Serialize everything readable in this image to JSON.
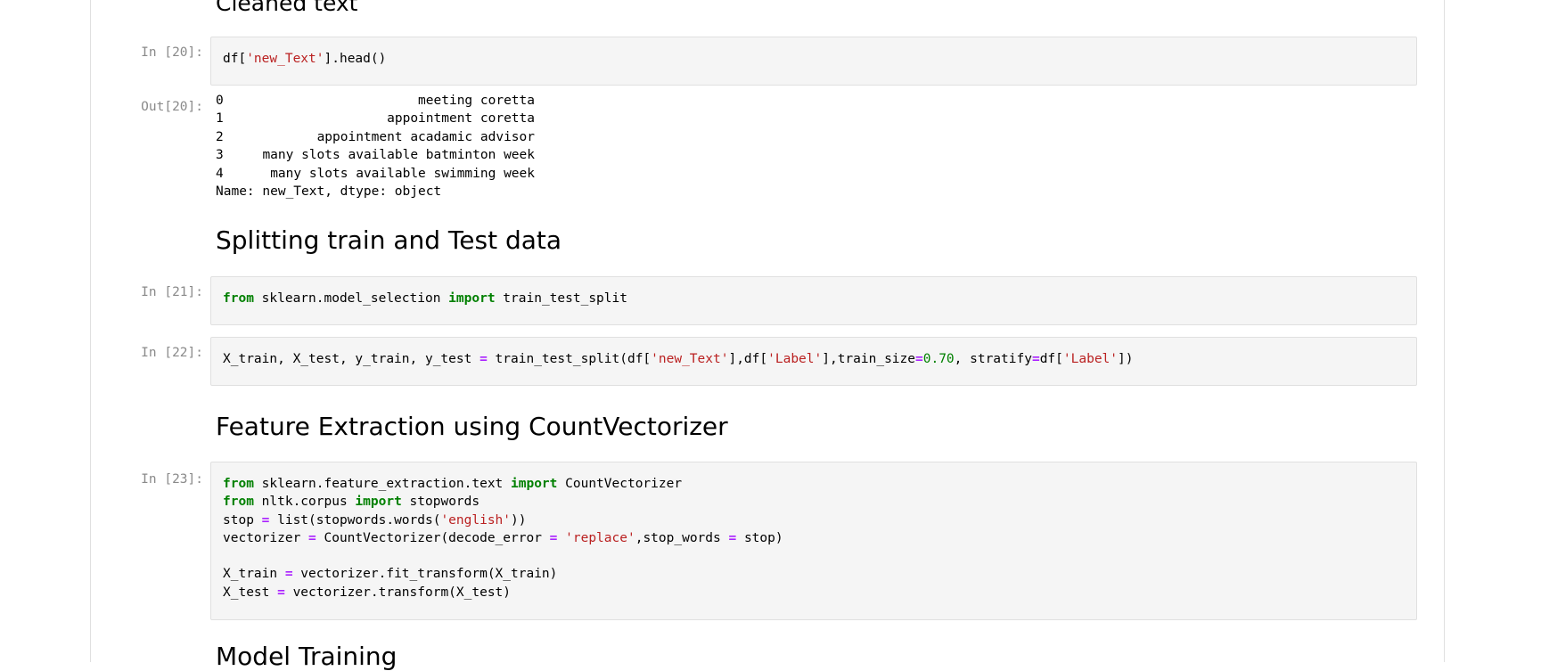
{
  "headings": {
    "cleaned": "Cleaned text",
    "split": "Splitting train and Test data",
    "feature": "Feature Extraction using CountVectorizer",
    "model": "Model Training"
  },
  "cells": {
    "c20": {
      "prompt": "In [20]:",
      "tokens": [
        "df[",
        "'new_Text'",
        "].head()"
      ]
    },
    "out20": {
      "prompt": "Out[20]:",
      "rows": [
        {
          "index": "0",
          "value": "meeting coretta"
        },
        {
          "index": "1",
          "value": "appointment coretta"
        },
        {
          "index": "2",
          "value": "appointment acadamic advisor"
        },
        {
          "index": "3",
          "value": "many slots available batminton week"
        },
        {
          "index": "4",
          "value": "many slots available swimming week"
        }
      ],
      "footer": "Name: new_Text, dtype: object"
    },
    "c21": {
      "prompt": "In [21]:",
      "tokens": [
        "from",
        " sklearn.model_selection ",
        "import",
        " train_test_split"
      ]
    },
    "c22": {
      "prompt": "In [22]:",
      "tokens": [
        "X_train, X_test, y_train, y_test ",
        "=",
        " train_test_split(df[",
        "'new_Text'",
        "],df[",
        "'Label'",
        "],train_size",
        "=",
        "0.70",
        ", stratify",
        "=",
        "df[",
        "'Label'",
        "])"
      ]
    },
    "c23": {
      "prompt": "In [23]:",
      "line1": [
        "from",
        " sklearn.feature_extraction.text ",
        "import",
        " CountVectorizer"
      ],
      "line2": [
        "from",
        " nltk.corpus ",
        "import",
        " stopwords"
      ],
      "line3": [
        "stop ",
        "=",
        " list(stopwords.words(",
        "'english'",
        "))"
      ],
      "line4": [
        "vectorizer ",
        "=",
        " CountVectorizer(decode_error ",
        "=",
        " ",
        "'replace'",
        ",stop_words ",
        "=",
        " stop)"
      ],
      "line5": [
        "X_train ",
        "=",
        " vectorizer.fit_transform(X_train)"
      ],
      "line6": [
        "X_test ",
        "=",
        " vectorizer.transform(X_test)"
      ]
    }
  },
  "colors": {
    "keyword": "#008000",
    "operator": "#aa22ff",
    "string": "#ba2121",
    "number": "#008000",
    "prompt": "#8a8a8a",
    "cell_background": "#f5f5f5"
  }
}
